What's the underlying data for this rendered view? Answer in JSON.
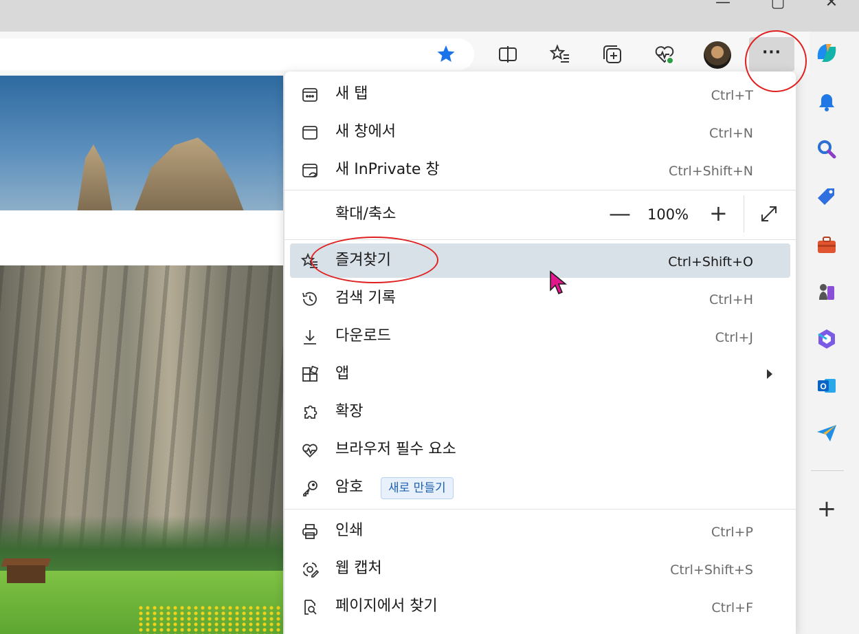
{
  "window": {
    "minimize_label": "—",
    "maximize_label": "▢",
    "close_label": "✕"
  },
  "toolbar": {
    "more_label": "···",
    "icons": [
      "favorite-star-icon",
      "split-screen-icon",
      "favorites-icon",
      "collections-icon",
      "browser-essentials-icon",
      "profile-avatar",
      "more-options-icon"
    ]
  },
  "menu": {
    "items_top": [
      {
        "icon": "new-tab-icon",
        "label": "새 탭",
        "shortcut": "Ctrl+T"
      },
      {
        "icon": "new-window-icon",
        "label": "새 창에서",
        "shortcut": "Ctrl+N"
      },
      {
        "icon": "inprivate-window-icon",
        "label": "새 InPrivate 창",
        "shortcut": "Ctrl+Shift+N"
      }
    ],
    "zoom": {
      "label": "확대/축소",
      "minus": "—",
      "value": "100%",
      "plus": "+"
    },
    "items_mid": [
      {
        "icon": "favorites-icon",
        "label": "즐겨찾기",
        "shortcut": "Ctrl+Shift+O",
        "highlighted": true
      },
      {
        "icon": "history-icon",
        "label": "검색 기록",
        "shortcut": "Ctrl+H"
      },
      {
        "icon": "download-icon",
        "label": "다운로드",
        "shortcut": "Ctrl+J"
      },
      {
        "icon": "apps-icon",
        "label": "앱",
        "shortcut": ""
      },
      {
        "icon": "extensions-icon",
        "label": "확장",
        "shortcut": ""
      },
      {
        "icon": "browser-essentials-icon",
        "label": "브라우저 필수 요소",
        "shortcut": ""
      },
      {
        "icon": "password-key-icon",
        "label": "암호",
        "shortcut": "",
        "badge": "새로 만들기"
      }
    ],
    "items_bottom": [
      {
        "icon": "print-icon",
        "label": "인쇄",
        "shortcut": "Ctrl+P"
      },
      {
        "icon": "web-capture-icon",
        "label": "웹 캡처",
        "shortcut": "Ctrl+Shift+S"
      },
      {
        "icon": "find-on-page-icon",
        "label": "페이지에서 찾기",
        "shortcut": "Ctrl+F"
      }
    ]
  },
  "sidebar": {
    "add_label": "+",
    "icons": [
      "copilot-icon",
      "notifications-bell-icon",
      "search-icon",
      "shopping-tag-icon",
      "tools-toolbox-icon",
      "games-chess-icon",
      "microsoft365-icon",
      "outlook-icon",
      "send-telegram-icon"
    ]
  },
  "colors": {
    "accent_blue": "#1a73e8",
    "highlight": "#d8e0e8",
    "annotation_red": "#e02020",
    "cursor_magenta": "#e0188c"
  }
}
